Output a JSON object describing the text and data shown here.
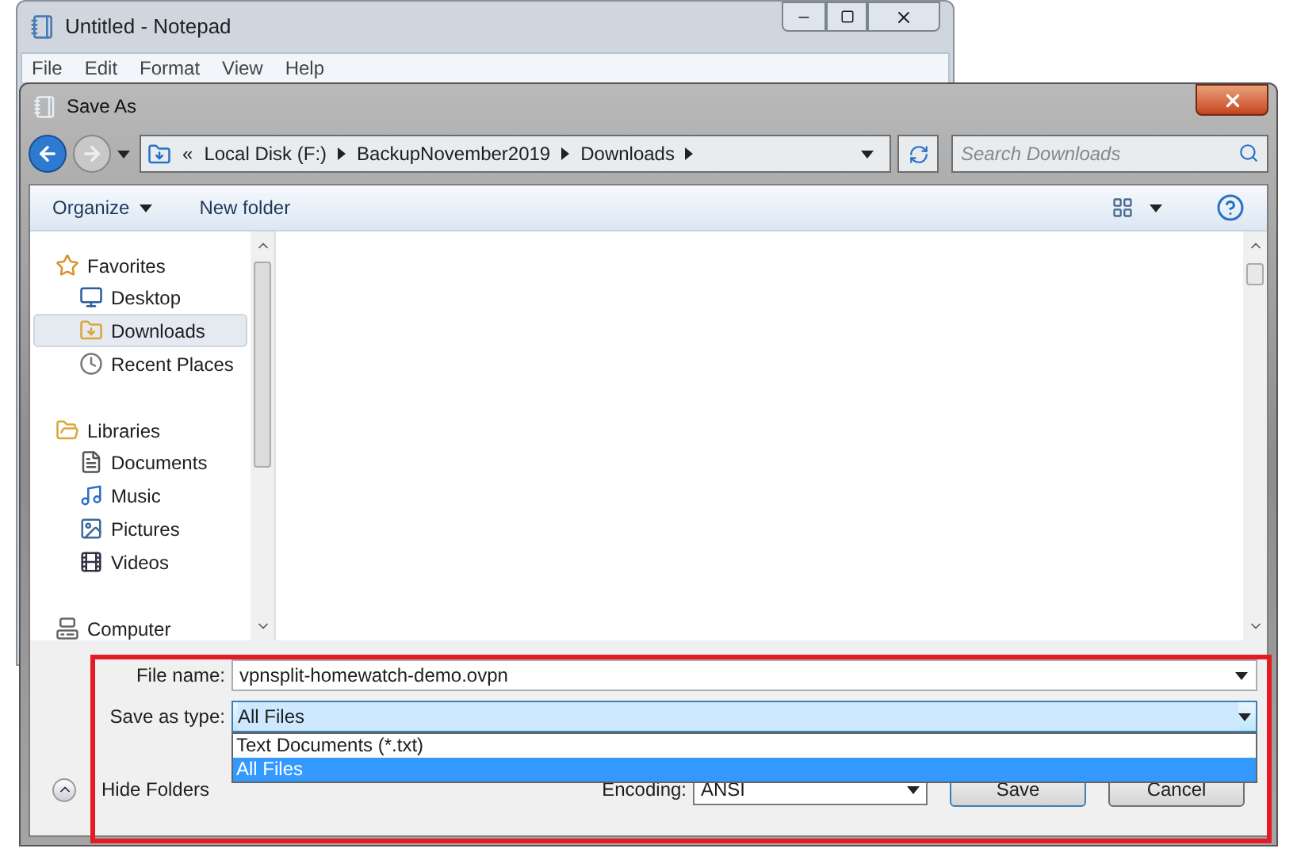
{
  "notepad": {
    "title": "Untitled - Notepad",
    "menu": [
      "File",
      "Edit",
      "Format",
      "View",
      "Help"
    ]
  },
  "dialog": {
    "title": "Save As",
    "breadcrumb": {
      "overflow": "«",
      "segments": [
        "Local Disk (F:)",
        "BackupNovember2019",
        "Downloads"
      ]
    },
    "search": {
      "placeholder": "Search Downloads"
    },
    "toolbar": {
      "organize": "Organize",
      "new_folder": "New folder"
    },
    "nav": [
      {
        "label": "Favorites",
        "children": [
          {
            "label": "Desktop",
            "selected": false
          },
          {
            "label": "Downloads",
            "selected": true
          },
          {
            "label": "Recent Places",
            "selected": false
          }
        ]
      },
      {
        "label": "Libraries",
        "children": [
          {
            "label": "Documents",
            "selected": false
          },
          {
            "label": "Music",
            "selected": false
          },
          {
            "label": "Pictures",
            "selected": false
          },
          {
            "label": "Videos",
            "selected": false
          }
        ]
      },
      {
        "label": "Computer"
      }
    ],
    "file_name": {
      "label": "File name:",
      "value": "vpnsplit-homewatch-demo.ovpn"
    },
    "save_type": {
      "label": "Save as type:",
      "value": "All Files",
      "expanded": true,
      "options": [
        {
          "label": "Text Documents (*.txt)",
          "selected": false
        },
        {
          "label": "All Files",
          "selected": true
        }
      ]
    },
    "hide_folders": "Hide Folders",
    "encoding": {
      "label": "Encoding:",
      "value": "ANSI"
    },
    "buttons": [
      "Save",
      "Cancel"
    ]
  }
}
